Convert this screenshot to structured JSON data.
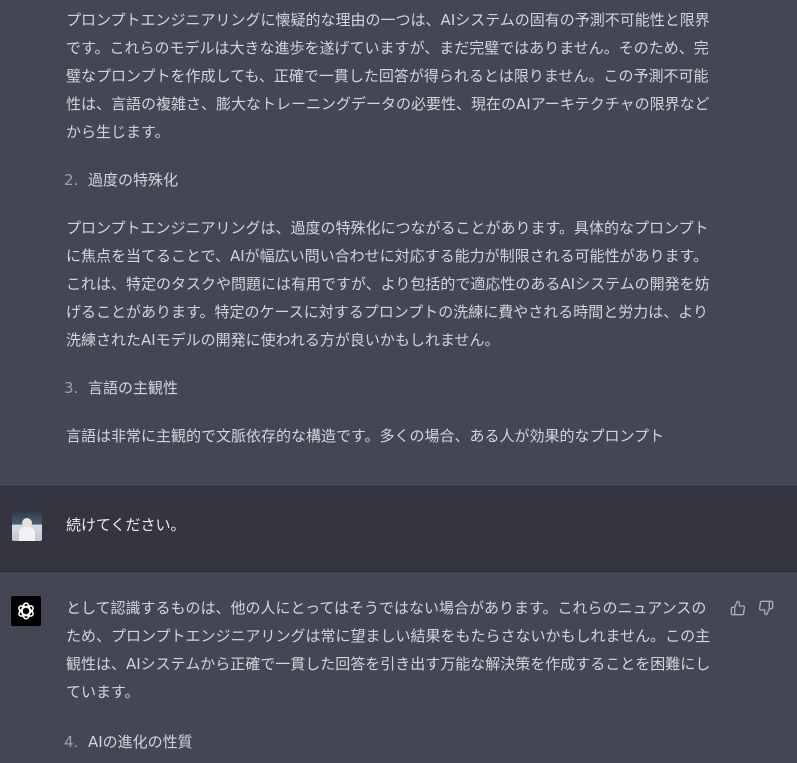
{
  "messages": {
    "assistant_top": {
      "para1": "プロンプトエンジニアリングに懐疑的な理由の一つは、AIシステムの固有の予測不可能性と限界です。これらのモデルは大きな進歩を遂げていますが、まだ完璧ではありません。そのため、完璧なプロンプトを作成しても、正確で一貫した回答が得られるとは限りません。この予測不可能性は、言語の複雑さ、膨大なトレーニングデータの必要性、現在のAIアーキテクチャの限界などから生じます。",
      "item2_num": "2.",
      "item2_title": "過度の特殊化",
      "para2": "プロンプトエンジニアリングは、過度の特殊化につながることがあります。具体的なプロンプトに焦点を当てることで、AIが幅広い問い合わせに対応する能力が制限される可能性があります。これは、特定のタスクや問題には有用ですが、より包括的で適応性のあるAIシステムの開発を妨げることがあります。特定のケースに対するプロンプトの洗練に費やされる時間と労力は、より洗練されたAIモデルの開発に使われる方が良いかもしれません。",
      "item3_num": "3.",
      "item3_title": "言語の主観性",
      "para3": "言語は非常に主観的で文脈依存的な構造です。多くの場合、ある人が効果的なプロンプト"
    },
    "user": {
      "text": "続けてください。"
    },
    "assistant_bottom": {
      "para1": "として認識するものは、他の人にとってはそうではない場合があります。これらのニュアンスのため、プロンプトエンジニアリングは常に望ましい結果をもたらさないかもしれません。この主観性は、AIシステムから正確で一貫した回答を引き出す万能な解決策を作成することを困難にしています。",
      "item4_num": "4.",
      "item4_title": "AIの進化の性質"
    }
  },
  "icons": {
    "thumbs_up": "thumbs-up-icon",
    "thumbs_down": "thumbs-down-icon",
    "assistant_logo": "openai-logo-icon"
  },
  "colors": {
    "assistant_bg": "#444654",
    "user_bg": "#343541",
    "text": "#d1d5db",
    "list_number": "#9ca3af"
  }
}
